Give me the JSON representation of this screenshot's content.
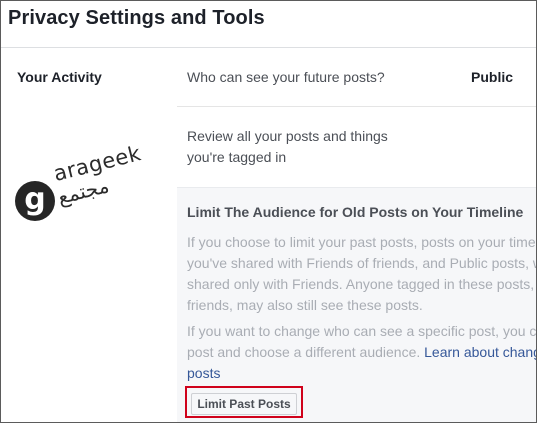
{
  "page": {
    "title": "Privacy Settings and Tools"
  },
  "your_activity": {
    "section_label": "Your Activity",
    "future_posts": {
      "question": "Who can see your future posts?",
      "value": "Public"
    },
    "review_posts": {
      "line1": "Review all your posts and things",
      "line2": "you're tagged in"
    }
  },
  "limit_panel": {
    "title": "Limit The Audience for Old Posts on Your Timeline",
    "paragraph1": [
      "If you choose to limit your past posts, posts on your timeline",
      "you've shared with Friends of friends, and Public posts, will be",
      "shared only with Friends. Anyone tagged in these posts, and their",
      "friends, may also still see these posts."
    ],
    "paragraph2": {
      "line1": "If you want to change who can see a specific post, you can go to that",
      "line2_text": "post and choose a different audience. ",
      "link_part1": "Learn about changing old",
      "link_part2": "posts"
    },
    "button_label": "Limit Past Posts"
  },
  "watermark": {
    "latin": "arageek",
    "arabic": "مجتمع",
    "monogram": "g"
  },
  "colors": {
    "highlight": "#d0021b",
    "link": "#365899",
    "muted_text": "#a9adb4",
    "panel_bg": "#f6f7f9"
  }
}
